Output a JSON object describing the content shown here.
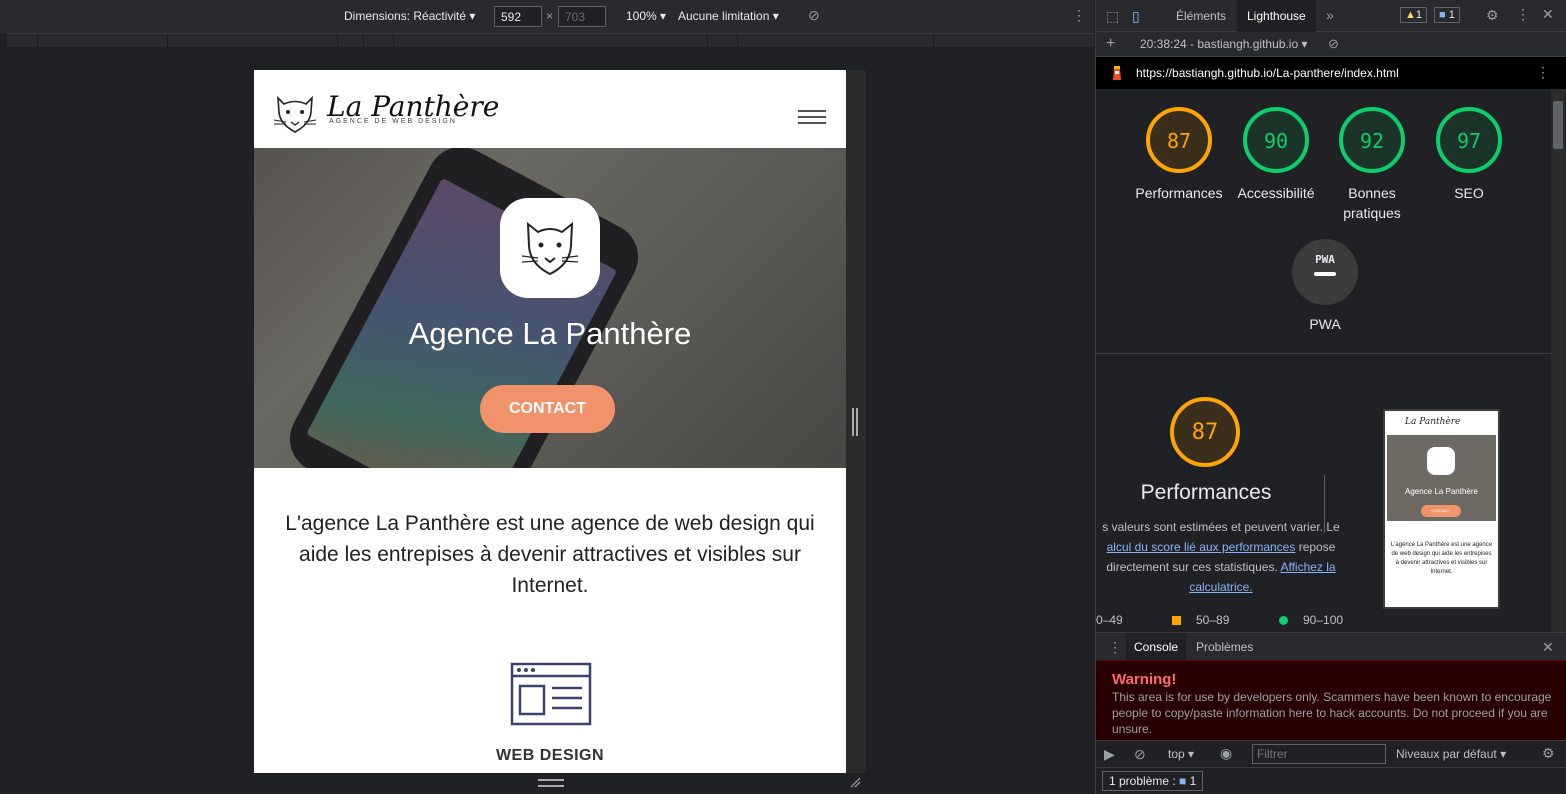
{
  "device_toolbar": {
    "dimensions_label": "Dimensions: Réactivité",
    "width": "592",
    "height": "703",
    "zoom": "100%",
    "throttle": "Aucune limitation"
  },
  "site": {
    "brand_name": "La Panthère",
    "brand_tagline": "AGENCE DE WEB DESIGN",
    "hero_title": "Agence La Panthère",
    "contact_label": "CONTACT",
    "intro_text": "L'agence La Panthère est une agence de web design qui aide les entrepises à devenir attractives et visibles sur Internet.",
    "service_label": "WEB DESIGN"
  },
  "devtools": {
    "tabs": [
      "Éléments",
      "Lighthouse"
    ],
    "warnings_count": "1",
    "messages_count": "1",
    "report_selector": "20:38:24 - bastiangh.github.io",
    "report_url": "https://bastiangh.github.io/La-panthere/index.html",
    "scores": [
      {
        "label": "Performances",
        "value": "87",
        "color": "#ffa400"
      },
      {
        "label": "Accessibilité",
        "value": "90",
        "color": "#0cce6b"
      },
      {
        "label": "Bonnes pratiques",
        "value": "92",
        "color": "#0cce6b"
      },
      {
        "label": "SEO",
        "value": "97",
        "color": "#0cce6b"
      }
    ],
    "pwa_badge": "PWA",
    "pwa_label": "PWA",
    "perf_section": {
      "score": "87",
      "title": "Performances",
      "desc_1": "s valeurs sont estimées et peuvent varier. Le",
      "desc_link": "alcul du score lié aux performances",
      "desc_2": " repose",
      "desc_3": "directement sur ces statistiques. ",
      "calc_link_1": "Affichez la",
      "calc_link_2": "calculatrice.",
      "legend": [
        "0–49",
        "50–89",
        "90–100"
      ]
    },
    "thumb": {
      "brand": "La Panthère",
      "title": "Agence La Panthère",
      "contact": "CONTACT",
      "text": "L'agence La Panthère est une agence de web design qui aide les entrepises à devenir attractives et visibles sur Internet."
    },
    "console_tabs": [
      "Console",
      "Problèmes"
    ],
    "warning_title": "Warning!",
    "warning_text": "This area is for use by developers only. Scammers have been known to encourage people to copy/paste information here to hack accounts. Do not proceed if you are unsure.",
    "context": "top",
    "filter_placeholder": "Filtrer",
    "levels": "Niveaux par défaut",
    "issues_label": "1 problème :",
    "issues_count": "1"
  }
}
